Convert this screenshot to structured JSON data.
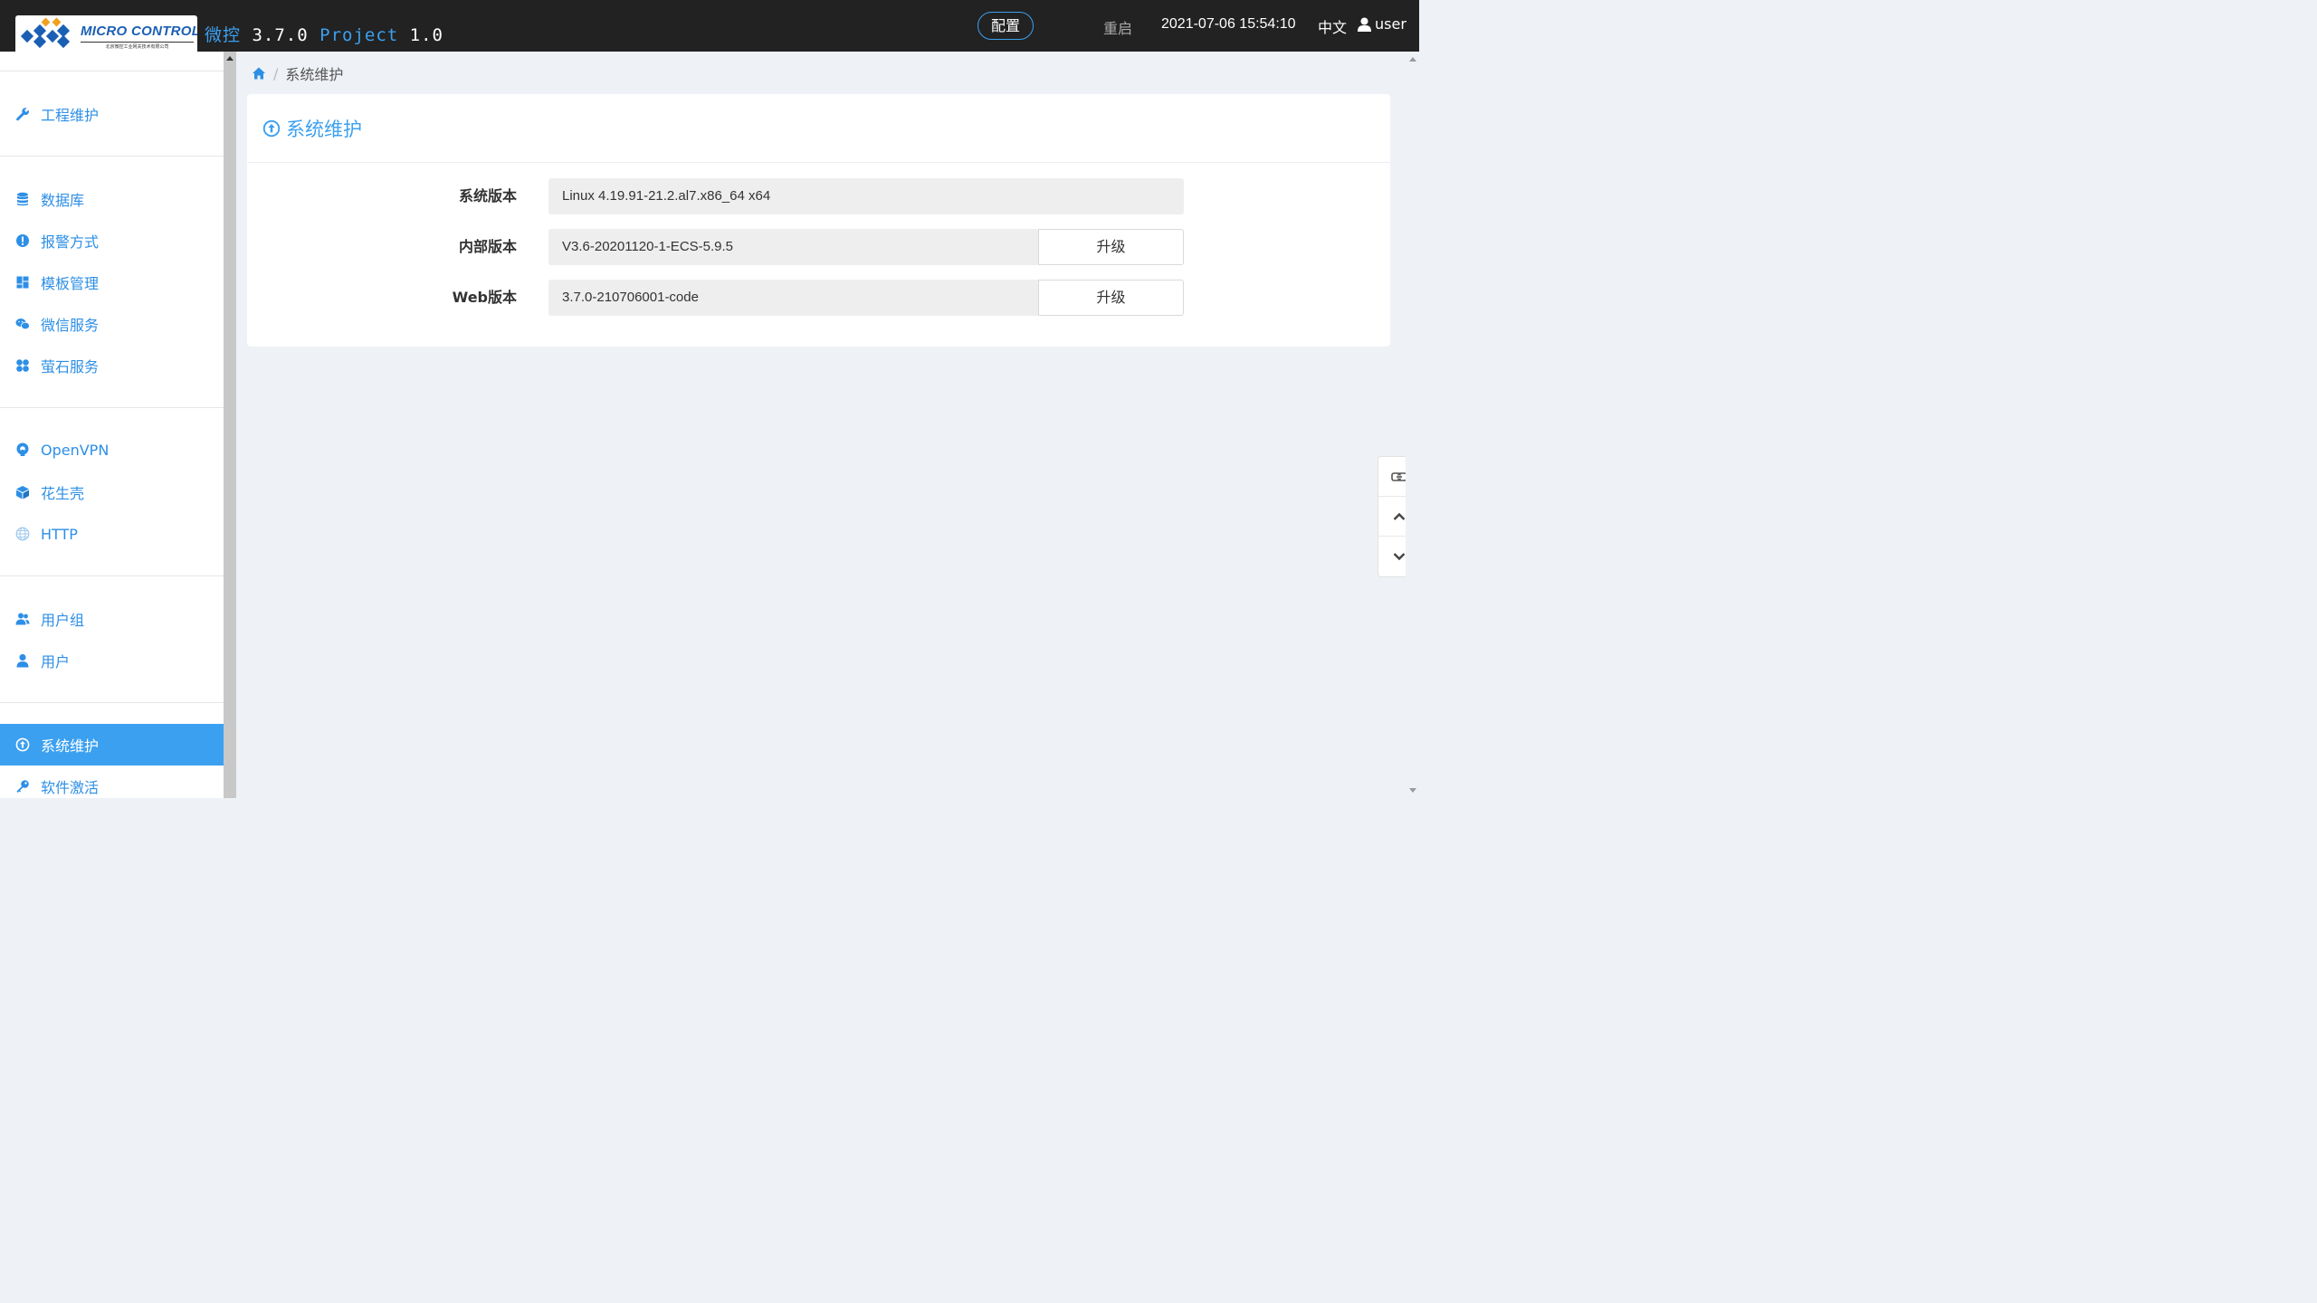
{
  "header": {
    "logo_text": "MICRO CONTROL",
    "logo_subtitle": "北京微控工业网关技术有限公司",
    "title_brand": "微控",
    "title_version": "3.7.0",
    "title_project": "Project",
    "title_project_version": "1.0",
    "config_label": "配置",
    "restart_label": "重启",
    "datetime": "2021-07-06 15:54:10",
    "language": "中文",
    "username": "user"
  },
  "sidebar": {
    "items": [
      {
        "label": "工程维护",
        "icon": "wrench-icon"
      },
      {
        "label": "数据库",
        "icon": "database-icon"
      },
      {
        "label": "报警方式",
        "icon": "alert-icon"
      },
      {
        "label": "模板管理",
        "icon": "dashboard-icon"
      },
      {
        "label": "微信服务",
        "icon": "wechat-icon"
      },
      {
        "label": "萤石服务",
        "icon": "fan-icon"
      },
      {
        "label": "OpenVPN",
        "icon": "openvpn-icon"
      },
      {
        "label": "花生壳",
        "icon": "cube-icon"
      },
      {
        "label": "HTTP",
        "icon": "globe-icon"
      },
      {
        "label": "用户组",
        "icon": "users-icon"
      },
      {
        "label": "用户",
        "icon": "user-icon"
      },
      {
        "label": "系统维护",
        "icon": "upload-circle-icon",
        "active": true
      },
      {
        "label": "软件激活",
        "icon": "key-icon"
      }
    ]
  },
  "breadcrumb": {
    "current": "系统维护"
  },
  "panel": {
    "title": "系统维护",
    "rows": [
      {
        "label": "系统版本",
        "value": "Linux 4.19.91-21.2.al7.x86_64 x64"
      },
      {
        "label": "内部版本",
        "value": "V3.6-20201120-1-ECS-5.9.5",
        "button": "升级"
      },
      {
        "label": "Web版本",
        "value": "3.7.0-210706001-code",
        "button": "升级"
      }
    ]
  },
  "colors": {
    "header_bg": "#222222",
    "accent": "#3ca0f0",
    "page_bg": "#eef1f5"
  }
}
